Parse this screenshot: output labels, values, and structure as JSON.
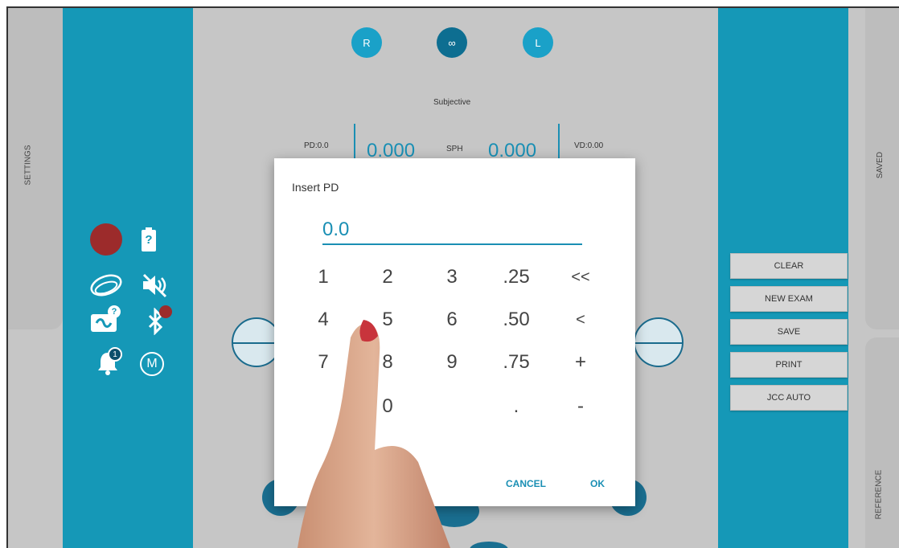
{
  "left_tab": {
    "label": "SETTINGS"
  },
  "right_tabs": {
    "saved": "SAVED",
    "reference": "REFERENCE"
  },
  "eye_selector": [
    {
      "label": "R",
      "active": false
    },
    {
      "label": "∞",
      "active": true
    },
    {
      "label": "L",
      "active": false
    }
  ],
  "exam": {
    "mode": "Subjective",
    "pd": "PD:0.0",
    "vd": "VD:0.00",
    "right_sph": "0.000",
    "sph_label": "SPH",
    "left_sph": "0.000"
  },
  "status_icons": {
    "record": "record-dot-icon",
    "battery": "battery-unknown-icon",
    "battery_symbol": "?",
    "lens": "lens-icon",
    "mute": "volume-mute-icon",
    "camera_badge": "?",
    "bluetooth": "bluetooth-icon",
    "bell_badge": "1",
    "manual": "M"
  },
  "actions": [
    "CLEAR",
    "NEW EXAM",
    "SAVE",
    "PRINT",
    "JCC AUTO"
  ],
  "dialog": {
    "title": "Insert PD",
    "value": "0.0",
    "keys": [
      [
        "1",
        "2",
        "3",
        ".25",
        "<<"
      ],
      [
        "4",
        "5",
        "6",
        ".50",
        "<"
      ],
      [
        "7",
        "8",
        "9",
        ".75",
        "+"
      ],
      [
        "",
        "0",
        "",
        ".",
        "-"
      ]
    ],
    "cancel": "CANCEL",
    "ok": "OK"
  },
  "colors": {
    "accent": "#1598b7",
    "accent_dark": "#0d6e91",
    "record": "#9c2b2b",
    "background": "#c6c6c6"
  }
}
